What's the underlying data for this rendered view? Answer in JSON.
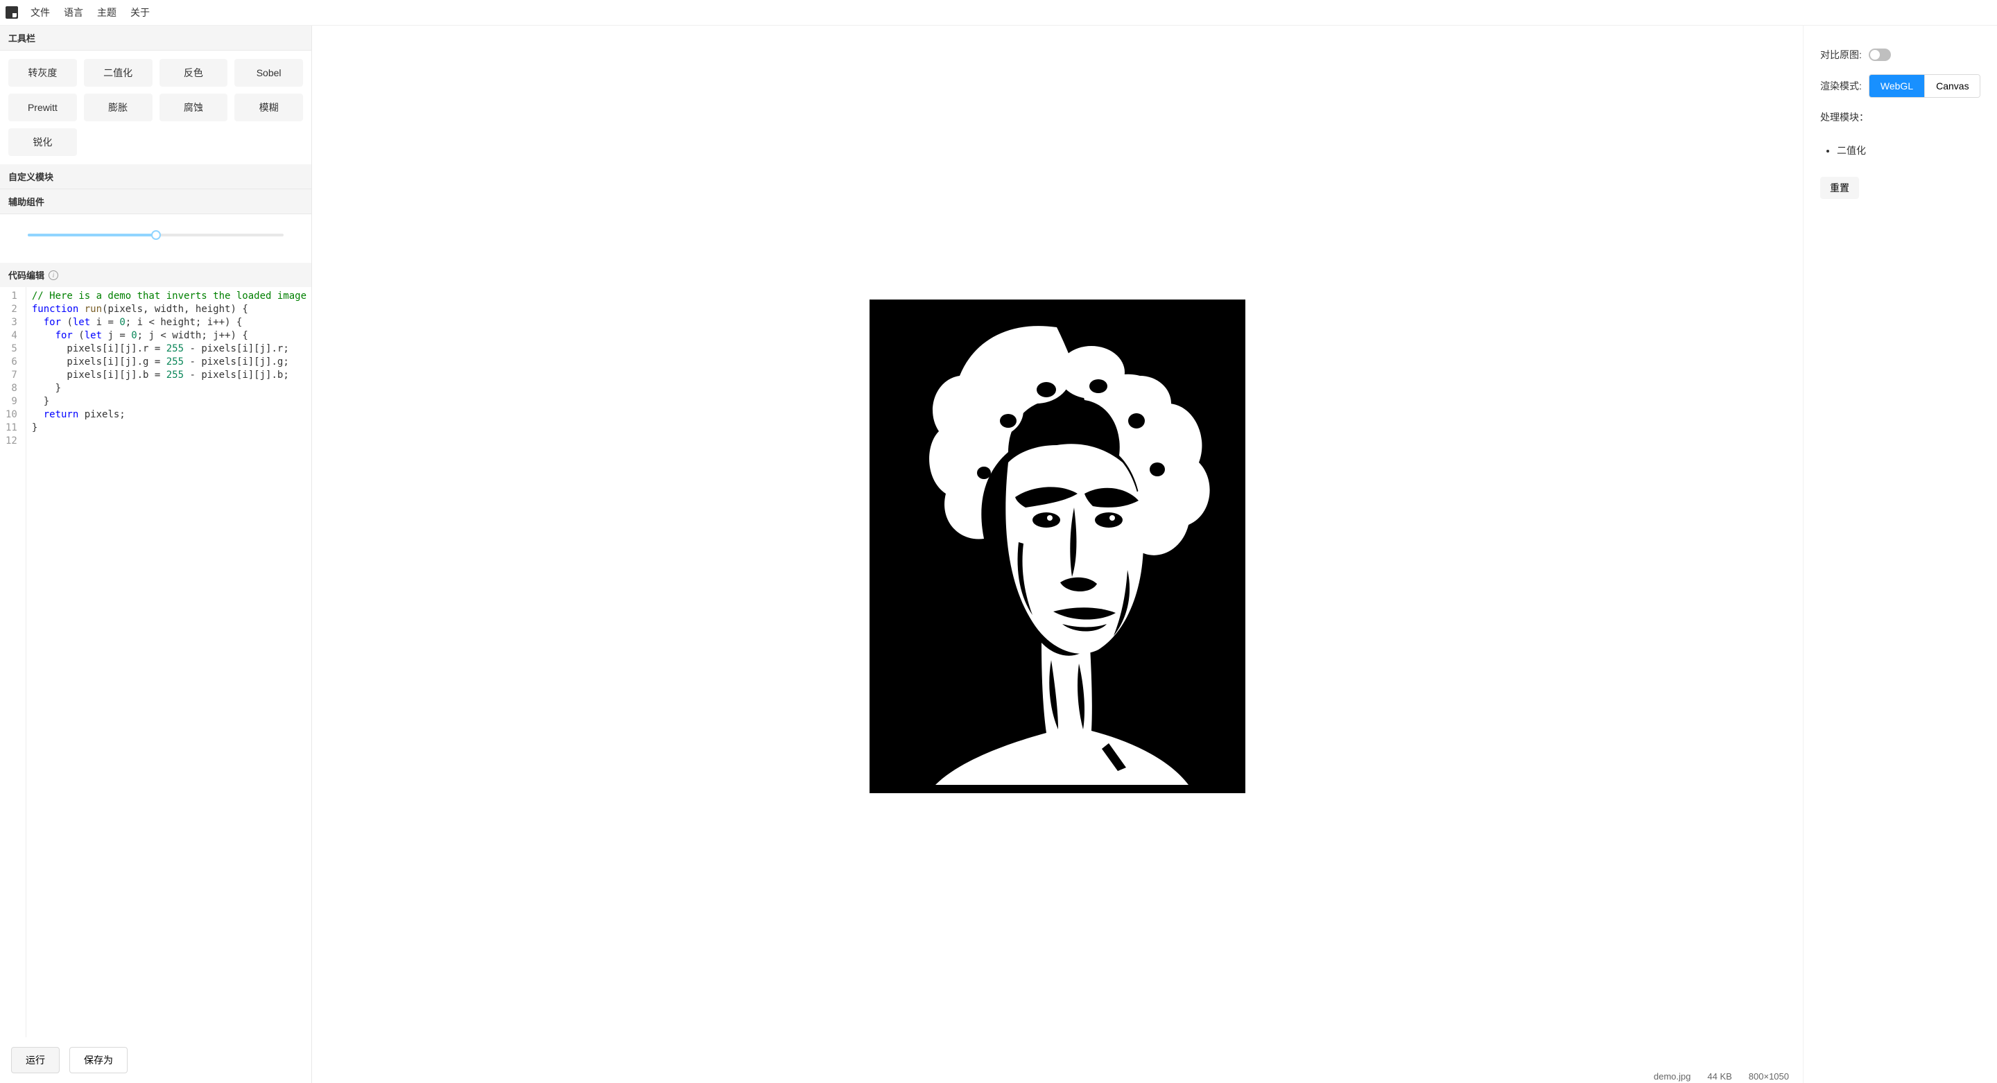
{
  "menubar": {
    "file": "文件",
    "language": "语言",
    "theme": "主题",
    "about": "关于"
  },
  "toolbox": {
    "header": "工具栏",
    "buttons": [
      "转灰度",
      "二值化",
      "反色",
      "Sobel",
      "Prewitt",
      "膨胀",
      "腐蚀",
      "模糊",
      "锐化"
    ]
  },
  "customModule": {
    "header": "自定义模块"
  },
  "auxWidgets": {
    "header": "辅助组件",
    "sliderValue": 50
  },
  "codeEditor": {
    "header": "代码编辑",
    "lines": [
      "// Here is a demo that inverts the loaded image",
      "function run(pixels, width, height) {",
      "  for (let i = 0; i < height; i++) {",
      "    for (let j = 0; j < width; j++) {",
      "      pixels[i][j].r = 255 - pixels[i][j].r;",
      "      pixels[i][j].g = 255 - pixels[i][j].g;",
      "      pixels[i][j].b = 255 - pixels[i][j].b;",
      "    }",
      "  }",
      "  return pixels;",
      "}",
      ""
    ]
  },
  "actions": {
    "run": "运行",
    "saveAs": "保存为"
  },
  "statusBar": {
    "filename": "demo.jpg",
    "size": "44 KB",
    "dimensions": "800×1050"
  },
  "rightPanel": {
    "compareLabel": "对比原图:",
    "renderModeLabel": "渲染模式:",
    "renderModes": {
      "webgl": "WebGL",
      "canvas": "Canvas"
    },
    "activeRenderMode": "webgl",
    "modulesLabel": "处理模块：",
    "modules": [
      "二值化"
    ],
    "reset": "重置"
  }
}
